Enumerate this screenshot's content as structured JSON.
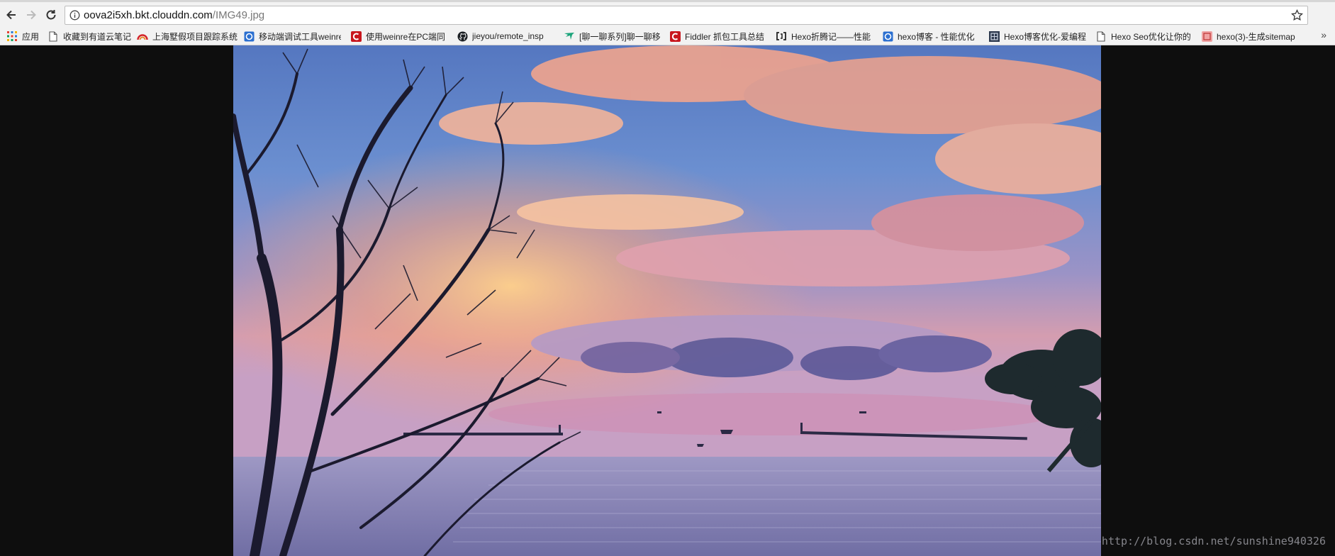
{
  "browser": {
    "url_host": "oova2i5xh.bkt.clouddn.com",
    "url_path": "/IMG49.jpg"
  },
  "bookmarks": [
    {
      "label": "应用",
      "icon": "apps-grid-icon"
    },
    {
      "label": "收藏到有道云笔记",
      "icon": "page-icon"
    },
    {
      "label": "上海墅假项目跟踪系统",
      "icon": "rainbow-icon"
    },
    {
      "label": "移动端调试工具weinre",
      "icon": "blue-circle-icon"
    },
    {
      "label": "使用weinre在PC端同",
      "icon": "csdn-c-icon"
    },
    {
      "label": "jieyou/remote_insp",
      "icon": "github-icon"
    },
    {
      "label": "[聊一聊系列]聊一聊移",
      "icon": "green-leaf-icon"
    },
    {
      "label": "Fiddler 抓包工具总结",
      "icon": "csdn-c-icon"
    },
    {
      "label": "Hexo折腾记——性能",
      "icon": "code-bracket-icon"
    },
    {
      "label": "hexo博客 - 性能优化",
      "icon": "blue-circle-icon"
    },
    {
      "label": "Hexo博客优化-爱编程",
      "icon": "dark-square-icon"
    },
    {
      "label": "Hexo Seo优化让你的",
      "icon": "page-icon"
    },
    {
      "label": "hexo(3)-生成sitemap",
      "icon": "pink-square-icon"
    }
  ],
  "overflow_label": "»",
  "image": {
    "watermark": "http://blog.csdn.net/sunshine940326"
  },
  "colors": {
    "page_background": "#0e0e0e",
    "sky_blue": "#5f86c8",
    "cloud_pink": "#f2a68f",
    "sea_violet": "#8a86b8"
  }
}
